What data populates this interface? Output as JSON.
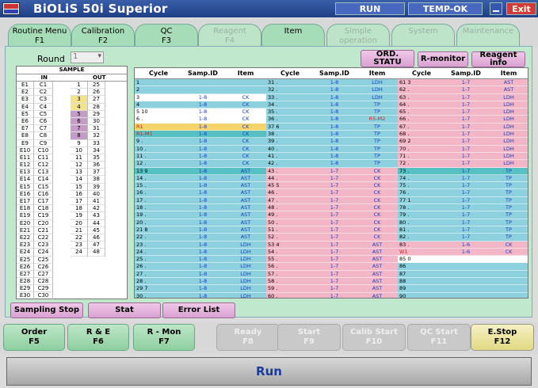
{
  "app": {
    "title": "BiOLiS 50i Superior",
    "run": "RUN",
    "temp": "TEMP-OK",
    "exit": "Exit"
  },
  "tabs": [
    {
      "name": "Routine Menu",
      "key": "F1",
      "state": "on"
    },
    {
      "name": "Calibration",
      "key": "F2",
      "state": "on"
    },
    {
      "name": "QC",
      "key": "F3",
      "state": "on"
    },
    {
      "name": "Reagent",
      "key": "F4",
      "state": "dis"
    },
    {
      "name": "Item",
      "key": "",
      "state": "on"
    },
    {
      "name": "Simple operation",
      "key": "",
      "state": "dis"
    },
    {
      "name": "System",
      "key": "",
      "state": "dis"
    },
    {
      "name": "Maintenance",
      "key": "",
      "state": "dis"
    }
  ],
  "round": {
    "label": "Round",
    "value": "1"
  },
  "buttons": {
    "ord": "ORD. STATU",
    "rmon": "R-monitor",
    "reagent": "Reagent info",
    "sampling_stop": "Sampling Stop",
    "stat": "Stat",
    "error_list": "Error List"
  },
  "sample": {
    "title": "SAMPLE",
    "in": "IN",
    "out": "OUT",
    "e": [
      "E1",
      "E2",
      "E3",
      "E4",
      "E5",
      "E6",
      "E7",
      "E8",
      "E9",
      "E10",
      "E11",
      "E12",
      "E13",
      "E14",
      "E15",
      "E16",
      "E17",
      "E18",
      "E19",
      "E20",
      "E21",
      "E22",
      "E23",
      "E24",
      "E25",
      "E26",
      "E27",
      "E28",
      "E29",
      "E30"
    ],
    "c": [
      "C1",
      "C2",
      "C3",
      "C4",
      "C5",
      "C6",
      "C7",
      "C8",
      "C9",
      "C10",
      "C11",
      "C12",
      "C13",
      "C14",
      "C15",
      "C16",
      "C17",
      "C18",
      "C19",
      "C20",
      "C21",
      "C22",
      "C23",
      "C24",
      "C25",
      "C26",
      "C27",
      "C28",
      "C29",
      "C30"
    ],
    "o1": [
      "1",
      "2",
      "3",
      "4",
      "5",
      "6",
      "7",
      "8",
      "9",
      "10",
      "11",
      "12",
      "13",
      "14",
      "15",
      "16",
      "17",
      "18",
      "19",
      "20",
      "21",
      "22",
      "23",
      "24"
    ],
    "o2": [
      "25",
      "26",
      "27",
      "28",
      "29",
      "30",
      "31",
      "32",
      "33",
      "34",
      "35",
      "36",
      "37",
      "38",
      "39",
      "40",
      "41",
      "42",
      "43",
      "44",
      "45",
      "46",
      "47",
      "48"
    ]
  },
  "grid_header": {
    "cycle": "Cycle",
    "samp": "Samp.ID",
    "item": "Item"
  },
  "grid": [
    [
      [
        "1",
        "",
        "",
        "b"
      ],
      [
        "2",
        "",
        "",
        "b"
      ],
      [
        "3",
        "1-8",
        "CK",
        "w"
      ],
      [
        "4",
        "1-8",
        "CK",
        "b"
      ],
      [
        "5   10",
        "1-8",
        "CK",
        "w"
      ],
      [
        "6  .",
        "1-8",
        "CK",
        "w"
      ],
      [
        "R1",
        "1-8",
        "CK",
        "y"
      ],
      [
        "R1-M1",
        "1-8",
        "CK",
        "t"
      ],
      [
        "9  .",
        "1-8",
        "CK",
        "b"
      ],
      [
        "10  .",
        "1-8",
        "CK",
        "b"
      ],
      [
        "11  .",
        "1-8",
        "CK",
        "b"
      ],
      [
        "12  .",
        "1-8",
        "CK",
        "b"
      ],
      [
        "13   9",
        "1-8",
        "AST",
        "t"
      ],
      [
        "14  .",
        "1-8",
        "AST",
        "b"
      ],
      [
        "15  .",
        "1-8",
        "AST",
        "b"
      ],
      [
        "16  .",
        "1-8",
        "AST",
        "b"
      ],
      [
        "17  .",
        "1-8",
        "AST",
        "b"
      ],
      [
        "18  .",
        "1-8",
        "AST",
        "b"
      ],
      [
        "19  .",
        "1-8",
        "AST",
        "b"
      ],
      [
        "20  .",
        "1-8",
        "AST",
        "b"
      ],
      [
        "21   8",
        "1-8",
        "AST",
        "b"
      ],
      [
        "22  .",
        "1-8",
        "AST",
        "b"
      ],
      [
        "23  .",
        "1-8",
        "LDH",
        "b"
      ],
      [
        "24  .",
        "1-8",
        "LDH",
        "b"
      ],
      [
        "25  .",
        "1-8",
        "LDH",
        "b"
      ],
      [
        "26  .",
        "1-8",
        "LDH",
        "b"
      ],
      [
        "27  .",
        "1-8",
        "LDH",
        "b"
      ],
      [
        "28  .",
        "1-8",
        "LDH",
        "b"
      ],
      [
        "29   7",
        "1-8",
        "LDH",
        "b"
      ],
      [
        "30  .",
        "1-8",
        "LDH",
        "b"
      ]
    ],
    [
      [
        "31  .",
        "1-8",
        "LDH",
        "b"
      ],
      [
        "32  .",
        "1-8",
        "LDH",
        "b"
      ],
      [
        "33  .",
        "1-8",
        "LDH",
        "b"
      ],
      [
        "34  .",
        "1-8",
        "TP",
        "b"
      ],
      [
        "35  .",
        "1-8",
        "TP",
        "b"
      ],
      [
        "36  .",
        "1-8",
        "R5-M2",
        "b"
      ],
      [
        "37   6",
        "1-8",
        "TP",
        "b"
      ],
      [
        "38  .",
        "1-8",
        "TP",
        "b"
      ],
      [
        "39  .",
        "1-8",
        "TP",
        "b"
      ],
      [
        "40  .",
        "1-8",
        "TP",
        "b"
      ],
      [
        "41  .",
        "1-8",
        "TP",
        "b"
      ],
      [
        "42  .",
        "1-8",
        "TP",
        "b"
      ],
      [
        "43  .",
        "1-7",
        "CK",
        "p"
      ],
      [
        "44  .",
        "1-7",
        "CK",
        "p"
      ],
      [
        "45   5",
        "1-7",
        "CK",
        "p"
      ],
      [
        "46  .",
        "1-7",
        "CK",
        "p"
      ],
      [
        "47  .",
        "1-7",
        "CK",
        "p"
      ],
      [
        "48  .",
        "1-7",
        "CK",
        "p"
      ],
      [
        "49  .",
        "1-7",
        "CK",
        "p"
      ],
      [
        "50  .",
        "1-7",
        "CK",
        "p"
      ],
      [
        "51  .",
        "1-7",
        "CK",
        "p"
      ],
      [
        "52  .",
        "1-7",
        "CK",
        "p"
      ],
      [
        "53   4",
        "1-7",
        "AST",
        "p"
      ],
      [
        "54  .",
        "1-7",
        "AST",
        "p"
      ],
      [
        "55  .",
        "1-7",
        "AST",
        "p"
      ],
      [
        "56  .",
        "1-7",
        "AST",
        "p"
      ],
      [
        "57  .",
        "1-7",
        "AST",
        "p"
      ],
      [
        "58  .",
        "1-7",
        "AST",
        "p"
      ],
      [
        "59  .",
        "1-7",
        "AST",
        "p"
      ],
      [
        "60  .",
        "1-7",
        "AST",
        "p"
      ]
    ],
    [
      [
        "61   3",
        "1-7",
        "AST",
        "p"
      ],
      [
        "62  .",
        "1-7",
        "AST",
        "p"
      ],
      [
        "63  .",
        "1-7",
        "LDH",
        "p"
      ],
      [
        "64  .",
        "1-7",
        "LDH",
        "p"
      ],
      [
        "65  .",
        "1-7",
        "LDH",
        "p"
      ],
      [
        "66  .",
        "1-7",
        "LDH",
        "p"
      ],
      [
        "67  .",
        "1-7",
        "LDH",
        "p"
      ],
      [
        "68  .",
        "1-7",
        "LDH",
        "p"
      ],
      [
        "69   2",
        "1-7",
        "LDH",
        "p"
      ],
      [
        "70  .",
        "1-7",
        "LDH",
        "p"
      ],
      [
        "71  .",
        "1-7",
        "LDH",
        "p"
      ],
      [
        "72  .",
        "1-7",
        "LDH",
        "p"
      ],
      [
        "73  .",
        "1-7",
        "TP",
        "t"
      ],
      [
        "74  .",
        "1-7",
        "TP",
        "b"
      ],
      [
        "75  .",
        "1-7",
        "TP",
        "b"
      ],
      [
        "76  .",
        "1-7",
        "TP",
        "b"
      ],
      [
        "77   1",
        "1-7",
        "TP",
        "b"
      ],
      [
        "78  .",
        "1-7",
        "TP",
        "b"
      ],
      [
        "79  .",
        "1-7",
        "TP",
        "b"
      ],
      [
        "80  .",
        "1-7",
        "TP",
        "b"
      ],
      [
        "81  .",
        "1-7",
        "TP",
        "b"
      ],
      [
        "82  .",
        "1-7",
        "TP",
        "b"
      ],
      [
        "83  .",
        "1-6",
        "CK",
        "p"
      ],
      [
        "W1",
        "1-6",
        "CK",
        "p"
      ],
      [
        "85   0",
        "",
        "",
        "w"
      ],
      [
        "86",
        "",
        "",
        "b"
      ],
      [
        "87",
        "",
        "",
        "b"
      ],
      [
        "88",
        "",
        "",
        "b"
      ],
      [
        "89",
        "",
        "",
        "b"
      ],
      [
        "90",
        "",
        "",
        "b"
      ]
    ]
  ],
  "fkeys": [
    {
      "label": "Order",
      "key": "F5",
      "state": "on"
    },
    {
      "label": "R & E",
      "key": "F6",
      "state": "on"
    },
    {
      "label": "R - Mon",
      "key": "F7",
      "state": "on"
    },
    {
      "label": "Ready",
      "key": "F8",
      "state": "dis"
    },
    {
      "label": "Start",
      "key": "F9",
      "state": "dis"
    },
    {
      "label": "Calib Start",
      "key": "F10",
      "state": "dis"
    },
    {
      "label": "QC Start",
      "key": "F11",
      "state": "dis"
    },
    {
      "label": "E.Stop",
      "key": "F12",
      "state": "stop"
    }
  ],
  "status": "Run"
}
